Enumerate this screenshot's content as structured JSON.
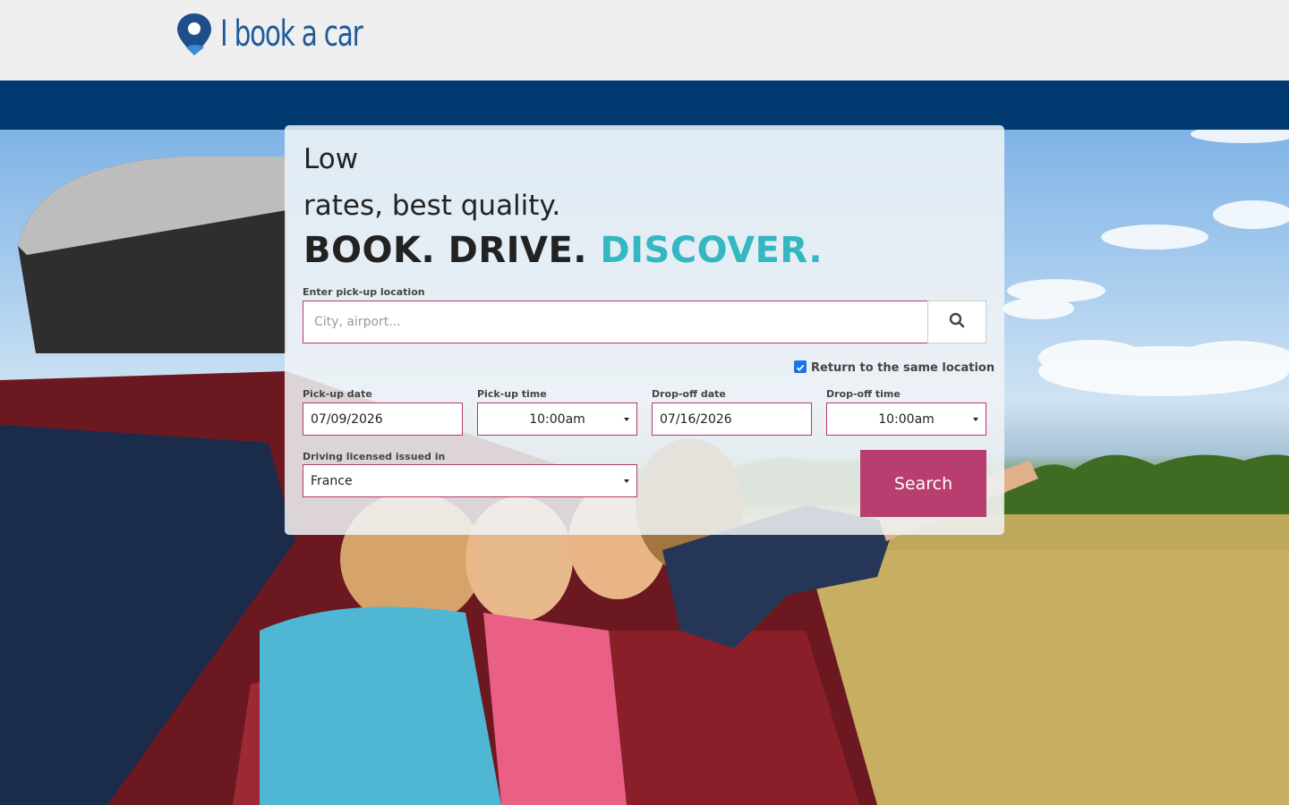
{
  "brand": {
    "name": "I book a car",
    "color": "#1f5b9a"
  },
  "hero": {
    "line1": "Low",
    "line2": "rates, best quality.",
    "slogan_main": "BOOK. DRIVE.",
    "slogan_accent": "DISCOVER.",
    "accent_color": "#35b7c1"
  },
  "form": {
    "location_label": "Enter pick-up location",
    "location_placeholder": "City, airport...",
    "return_same_label": "Return to the same location",
    "return_same_checked": true,
    "pickup_date_label": "Pick-up date",
    "pickup_date_value": "07/09/2026",
    "pickup_time_label": "Pick-up time",
    "pickup_time_value": "10:00am",
    "dropoff_date_label": "Drop-off date",
    "dropoff_date_value": "07/16/2026",
    "dropoff_time_label": "Drop-off time",
    "dropoff_time_value": "10:00am",
    "license_label": "Driving licensed issued in",
    "license_value": "France",
    "search_label": "Search",
    "search_color": "#b83e70"
  },
  "icons": {
    "search": "magnifier-icon",
    "logo": "location-pin-icon",
    "checkbox": "checkmark-icon"
  }
}
